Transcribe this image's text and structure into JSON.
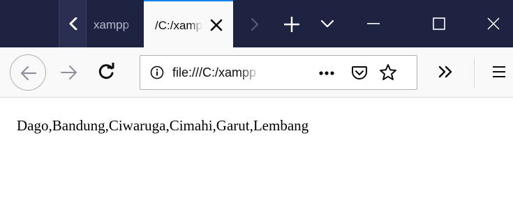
{
  "tabs": [
    {
      "title": "xampp",
      "active": false
    },
    {
      "title": "/C:/xampp",
      "active": true
    }
  ],
  "urlbar": {
    "url": "file:///C:/xampp"
  },
  "page": {
    "text": "Dago,Bandung,Ciwaruga,Cimahi,Garut,Lembang"
  },
  "colors": {
    "tabstrip": "#1e2342",
    "active_tab_accent": "#0a84ff",
    "toolbar": "#f9f9fa"
  },
  "icons": {
    "tab_scroll": "chevron-left-icon",
    "tab_close": "close-icon",
    "tab_scroll_right": "chevron-right-icon",
    "new_tab": "plus-icon",
    "all_tabs": "chevron-down-icon",
    "minimize": "minimize-icon",
    "maximize": "maximize-icon",
    "close_window": "close-icon",
    "back": "arrow-left-icon",
    "forward": "arrow-right-icon",
    "reload": "reload-icon",
    "site_info": "info-icon",
    "page_actions": "more-horizontal-icon",
    "pocket": "pocket-icon",
    "bookmark": "star-icon",
    "overflow": "double-chevron-right-icon",
    "menu": "hamburger-menu-icon"
  }
}
